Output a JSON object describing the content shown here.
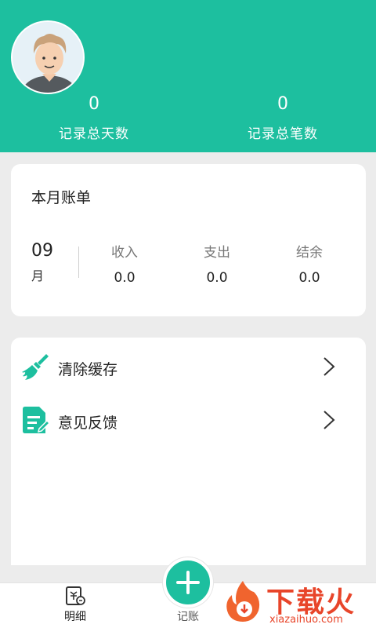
{
  "header": {
    "total_days_value": "0",
    "total_days_label": "记录总天数",
    "total_count_value": "0",
    "total_count_label": "记录总笔数"
  },
  "bill": {
    "title": "本月账单",
    "month": "09",
    "month_unit": "月",
    "income_label": "收入",
    "income_value": "0.0",
    "expense_label": "支出",
    "expense_value": "0.0",
    "balance_label": "结余",
    "balance_value": "0.0"
  },
  "menu": {
    "items": [
      {
        "label": "清除缓存",
        "icon": "broom-icon"
      },
      {
        "label": "意见反馈",
        "icon": "feedback-icon"
      }
    ]
  },
  "tabbar": {
    "detail_label": "明细",
    "record_label": "记账"
  },
  "watermark": {
    "brand": "下载火",
    "url": "xiazaihuo.com"
  },
  "colors": {
    "primary": "#1dbf9f",
    "background": "#ececec",
    "watermark": "#e8452a"
  }
}
